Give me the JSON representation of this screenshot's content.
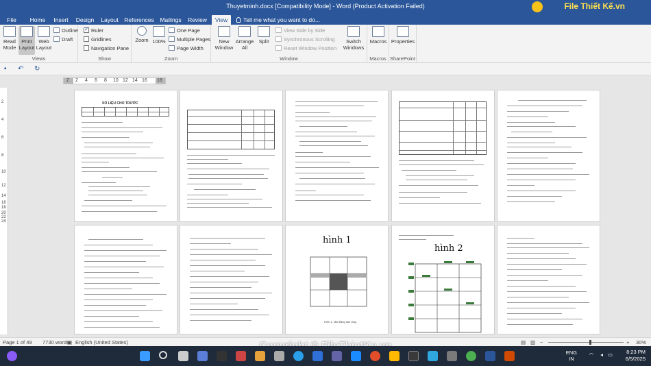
{
  "window": {
    "title": "Thuyetminh.docx [Compatibility Mode] - Word (Product Activation Failed)",
    "brand": "File Thiết Kế.vn"
  },
  "tabs": [
    "File",
    "Home",
    "Insert",
    "Design",
    "Layout",
    "References",
    "Mailings",
    "Review",
    "View"
  ],
  "active_tab": "View",
  "tell_me": "Tell me what you want to do...",
  "ribbon": {
    "views": {
      "label": "Views",
      "read_mode": "Read Mode",
      "print_layout": "Print Layout",
      "web_layout": "Web Layout",
      "outline": "Outline",
      "draft": "Draft"
    },
    "show": {
      "label": "Show",
      "ruler": "Ruler",
      "ruler_checked": true,
      "gridlines": "Gridlines",
      "gridlines_checked": false,
      "navigation_pane": "Navigation Pane",
      "navigation_pane_checked": false
    },
    "zoom": {
      "label": "Zoom",
      "zoom": "Zoom",
      "hundred": "100%",
      "one_page": "One Page",
      "multiple_pages": "Multiple Pages",
      "page_width": "Page Width"
    },
    "window": {
      "label": "Window",
      "new_window": "New Window",
      "arrange_all": "Arrange All",
      "split": "Split",
      "side_by_side": "View Side by Side",
      "sync_scrolling": "Synchronous Scrolling",
      "reset_position": "Reset Window Position",
      "switch_windows": "Switch Windows"
    },
    "macros": {
      "label": "Macros",
      "macros": "Macros"
    },
    "sharepoint": {
      "label": "SharePoint",
      "properties": "Properties"
    }
  },
  "ruler": {
    "marks": [
      "2",
      "2",
      "4",
      "6",
      "8",
      "10",
      "12",
      "14",
      "16",
      "18"
    ]
  },
  "vruler": {
    "marks": [
      "2",
      "4",
      "6",
      "8",
      "10",
      "12",
      "14",
      "16",
      "18",
      "20",
      "22",
      "24"
    ]
  },
  "pages": {
    "page1_heading": "SỐ LIỆU CHO TRƯỚC",
    "figure1_title": "hình 1",
    "figure1_caption": "Hình 1. Mặt bằng sàn tầng",
    "figure2_title": "hình 2"
  },
  "watermark": "Copyright © FileThietKe.vn",
  "status": {
    "page": "Page 1 of 49",
    "words": "7730 words",
    "language": "English (United States)",
    "zoom": "30%"
  },
  "taskbar": {
    "lang_top": "ENG",
    "lang_bottom": "IN",
    "time": "8:23 PM",
    "date": "6/5/2025"
  }
}
